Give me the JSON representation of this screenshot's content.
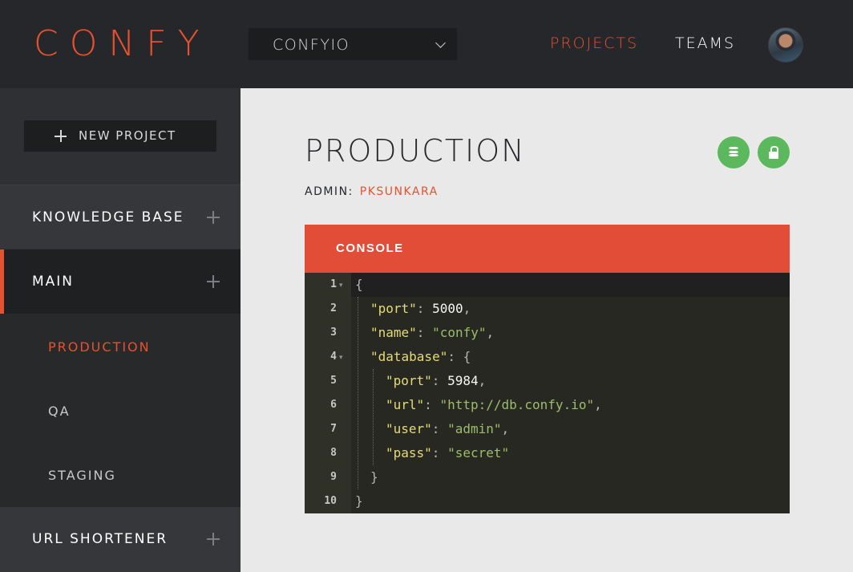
{
  "header": {
    "logo": "CONFY",
    "org_select": {
      "value": "CONFYIO"
    },
    "nav": {
      "projects": "PROJECTS",
      "teams": "TEAMS"
    }
  },
  "sidebar": {
    "new_project": "NEW PROJECT",
    "projects": [
      {
        "label": "KNOWLEDGE BASE"
      },
      {
        "label": "MAIN",
        "environments": [
          "PRODUCTION",
          "QA",
          "STAGING"
        ]
      },
      {
        "label": "URL SHORTENER"
      }
    ]
  },
  "main": {
    "title": "PRODUCTION",
    "admin_label": "ADMIN:",
    "admin_name": "PKSUNKARA",
    "console": {
      "title": "CONSOLE",
      "line_numbers": [
        "1",
        "2",
        "3",
        "4",
        "5",
        "6",
        "7",
        "8",
        "9",
        "10"
      ],
      "lines": [
        {
          "open": "{"
        },
        {
          "key": "\"port\"",
          "sep": ": ",
          "value": "5000",
          "tail": ","
        },
        {
          "key": "\"name\"",
          "sep": ": ",
          "value": "\"confy\"",
          "tail": ","
        },
        {
          "key": "\"database\"",
          "sep": ": ",
          "value": "{",
          "tail": ""
        },
        {
          "key": "\"port\"",
          "sep": ": ",
          "value": "5984",
          "tail": ","
        },
        {
          "key": "\"url\"",
          "sep": ": ",
          "value": "\"http://db.confy.io\"",
          "tail": ","
        },
        {
          "key": "\"user\"",
          "sep": ": ",
          "value": "\"admin\"",
          "tail": ","
        },
        {
          "key": "\"pass\"",
          "sep": ": ",
          "value": "\"secret\"",
          "tail": ""
        },
        {
          "close": "}"
        },
        {
          "close": "}"
        }
      ]
    }
  },
  "icons": {
    "org_select": "chevron-down-icon",
    "new_project": "plus-icon",
    "project_expand": "plus-icon",
    "database_button": "database-icon",
    "lock_button": "lock-icon",
    "console_fold": "fold-arrow-icon"
  },
  "colors": {
    "accent": "#e8512f",
    "console_header": "#e14d36",
    "action_button": "#5cb85c",
    "header_bg": "#25272a",
    "sidebar_bg": "#2e3033",
    "editor_bg": "#272822"
  }
}
